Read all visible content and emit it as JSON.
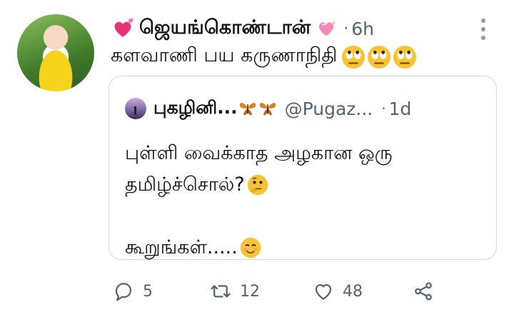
{
  "tweet": {
    "author": "ஜெயங்கொண்டான்",
    "time": "6h",
    "text": "களவாணி பய கருணாநிதி",
    "emojis": [
      "face-with-rolling-eyes",
      "face-with-rolling-eyes",
      "face-with-rolling-eyes"
    ]
  },
  "quoted": {
    "name": "புகழினி...",
    "handle": "@Pugaz...",
    "time": "1d",
    "line1": "புள்ளி வைக்காத அழகான ஒரு",
    "line2": "தமிழ்ச்சொல்?",
    "line3": "கூறுங்கள்.....",
    "line2_emoji": "thinking-face",
    "line3_emoji": "smiling-face"
  },
  "actions": {
    "replies": "5",
    "retweets": "12",
    "likes": "48"
  },
  "colors": {
    "text": "#0f1419",
    "secondary": "#536471",
    "border": "#cfd9de",
    "heart_pink": "#e8357a",
    "emoji_yellow": "#f7c534"
  }
}
